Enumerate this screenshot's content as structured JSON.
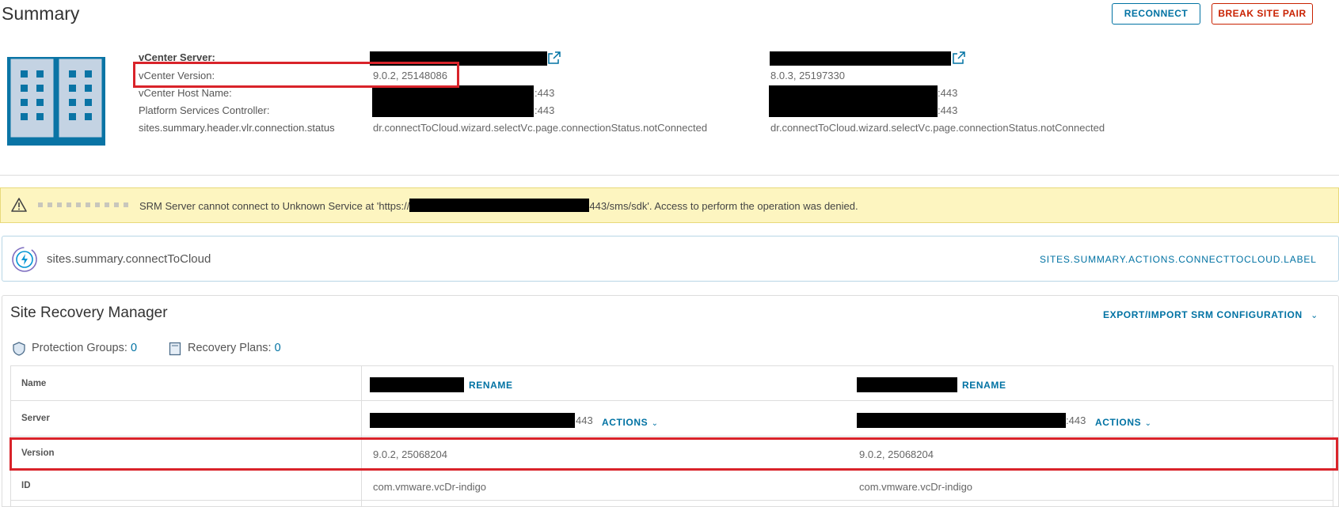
{
  "header": {
    "title": "Summary",
    "reconnect_label": "RECONNECT",
    "break_site_pair_label": "BREAK SITE PAIR"
  },
  "vcenter": {
    "labels": {
      "server": "vCenter Server:",
      "version": "vCenter Version:",
      "host_name": "vCenter Host Name:",
      "psc": "Platform Services Controller:",
      "connection_status": "sites.summary.header.vlr.connection.status"
    },
    "local": {
      "version": "9.0.2, 25148086",
      "host_port": ":443",
      "psc_port": ":443",
      "connection_status": "dr.connectToCloud.wizard.selectVc.page.connectionStatus.notConnected"
    },
    "remote": {
      "version": "8.0.3, 25197330",
      "host_port": ":443",
      "psc_port": ":443",
      "connection_status": "dr.connectToCloud.wizard.selectVc.page.connectionStatus.notConnected"
    }
  },
  "warning": {
    "text_before": "SRM Server cannot connect to Unknown Service at 'https://",
    "text_after": "443/sms/sdk'. Access to perform the operation was denied."
  },
  "cloud": {
    "label": "sites.summary.connectToCloud",
    "action_label": "SITES.SUMMARY.ACTIONS.CONNECTTOCLOUD.LABEL"
  },
  "srm": {
    "title": "Site Recovery Manager",
    "export_import_label": "EXPORT/IMPORT SRM CONFIGURATION",
    "protection_groups_label": "Protection Groups:",
    "protection_groups_count": "0",
    "recovery_plans_label": "Recovery Plans:",
    "recovery_plans_count": "0",
    "rows": {
      "name": "Name",
      "server": "Server",
      "version": "Version",
      "id": "ID"
    },
    "local": {
      "rename_label": "RENAME",
      "server_port": "443",
      "actions_label": "ACTIONS",
      "version": "9.0.2, 25068204",
      "id": "com.vmware.vcDr-indigo"
    },
    "remote": {
      "rename_label": "RENAME",
      "server_port": ":443",
      "actions_label": "ACTIONS",
      "version": "9.0.2, 25068204",
      "id": "com.vmware.vcDr-indigo"
    }
  },
  "colors": {
    "accent": "#0072a3",
    "danger": "#c92100",
    "highlight": "#d9232a",
    "warning_bg": "#fdf5c0"
  }
}
